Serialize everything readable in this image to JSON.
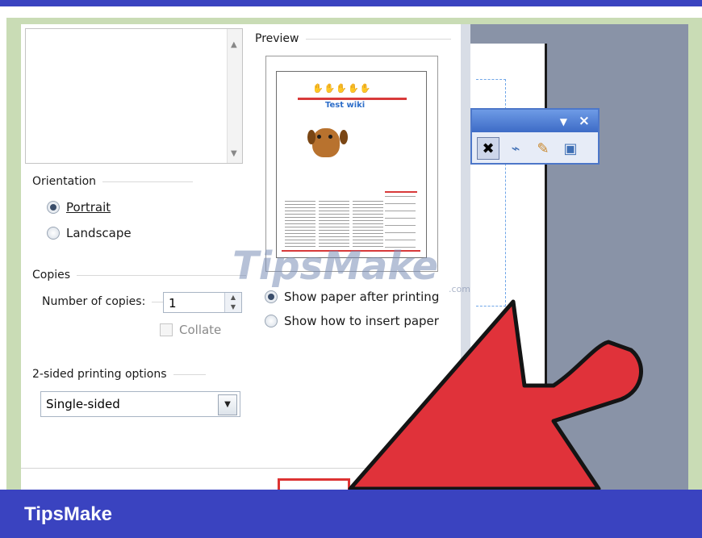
{
  "preview": {
    "label": "Preview",
    "doc_title": "Test wiki"
  },
  "orientation": {
    "label": "Orientation",
    "options": [
      {
        "label": "Portrait",
        "selected": true
      },
      {
        "label": "Landscape",
        "selected": false
      }
    ]
  },
  "copies": {
    "label": "Copies",
    "number_label": "Number of copies:",
    "value": "1",
    "collate_label": "Collate",
    "collate_checked": false
  },
  "duplex": {
    "label": "2-sided printing options",
    "value": "Single-sided"
  },
  "paper_options": [
    {
      "label": "Show paper after printing",
      "selected": true
    },
    {
      "label": "Show how to insert paper",
      "selected": false
    }
  ],
  "watermark": {
    "text": "TipsMake",
    "suffix": ".com"
  },
  "footer": {
    "brand": "TipsMake"
  },
  "colors": {
    "brand": "#3a43c0",
    "frame": "#c9dcb5",
    "arrow": "#e0323a"
  },
  "icons": {
    "toolbar": [
      "delete-icon",
      "format-painter-icon",
      "pencil-icon",
      "insert-picture-icon"
    ],
    "title_bar": [
      "dropdown-arrow-icon",
      "close-icon"
    ]
  }
}
